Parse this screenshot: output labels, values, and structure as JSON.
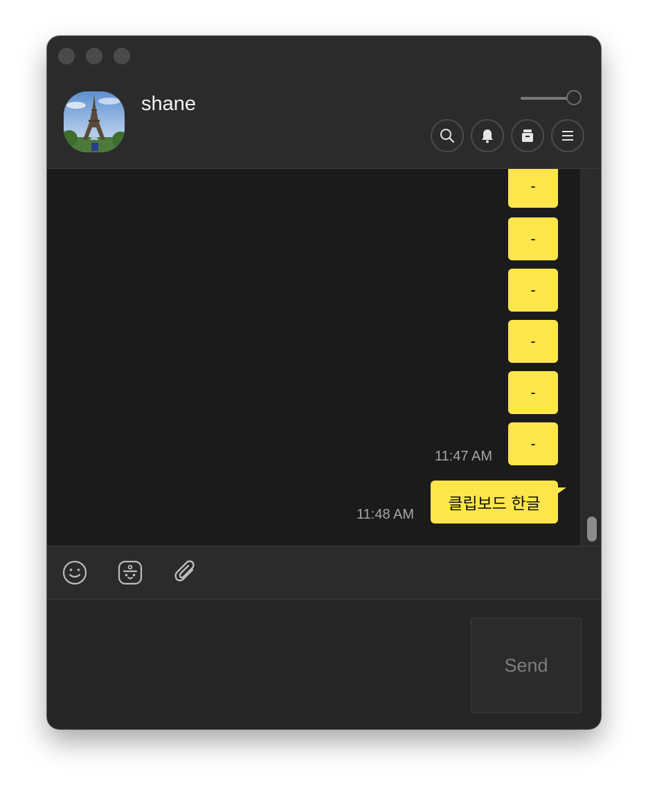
{
  "chat": {
    "username": "shane",
    "avatar_icon": "eiffel-tower-photo"
  },
  "header_buttons": [
    {
      "name": "search-icon"
    },
    {
      "name": "bell-icon"
    },
    {
      "name": "drawer-icon"
    },
    {
      "name": "menu-icon"
    }
  ],
  "messages": {
    "dashes": [
      "-",
      "-",
      "-",
      "-",
      "-",
      "-"
    ],
    "time_1": "11:47 AM",
    "last_text": "클립보드 한글",
    "time_2": "11:48 AM"
  },
  "composer": {
    "send_label": "Send",
    "placeholder": ""
  },
  "colors": {
    "bubble": "#fde64b",
    "background": "#1b1b1b",
    "window": "#2b2b2b"
  }
}
